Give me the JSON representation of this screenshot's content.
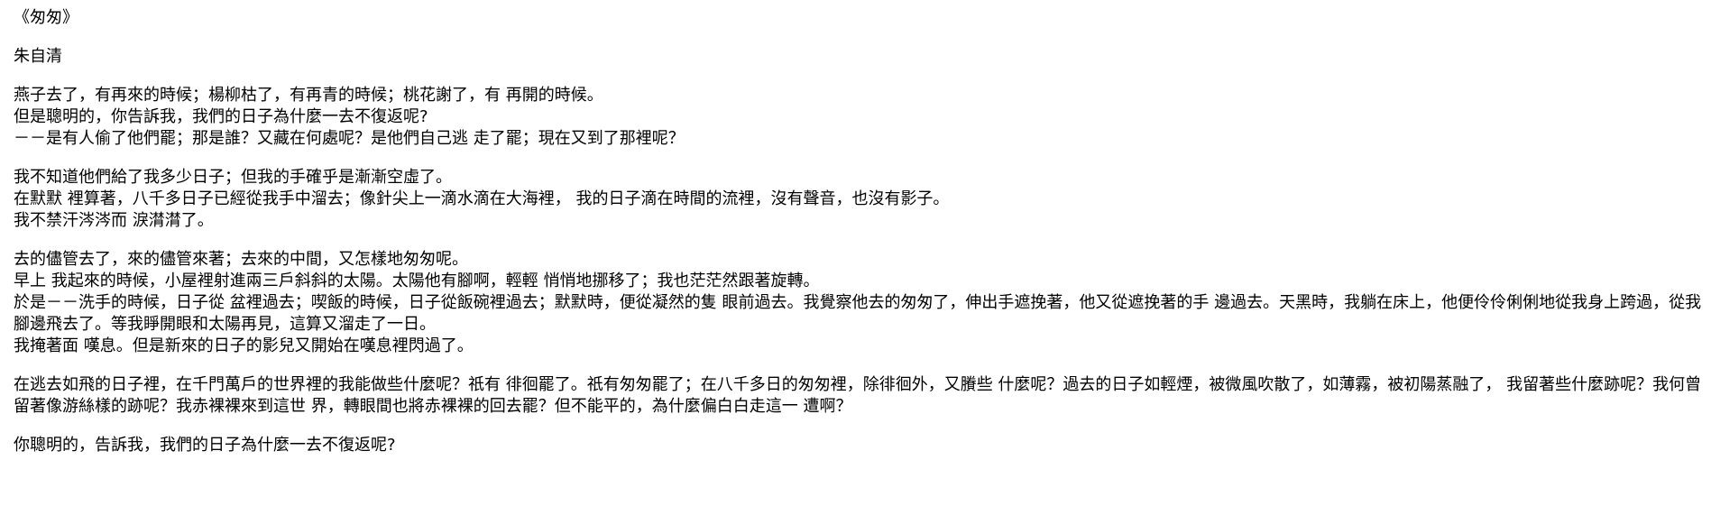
{
  "title": "《匆匆》",
  "author": "朱自清",
  "paragraphs": [
    {
      "lines": [
        "燕子去了，有再來的時候；楊柳枯了，有再青的時候；桃花謝了，有 再開的時候。",
        "但是聰明的，你告訴我，我們的日子為什麼一去不復返呢?",
        "－－是有人偷了他們罷；那是誰？又藏在何處呢？是他們自己逃 走了罷；現在又到了那裡呢？"
      ]
    },
    {
      "lines": [
        "我不知道他們給了我多少日子；但我的手確乎是漸漸空虛了。",
        "在默默 裡算著，八千多日子已經從我手中溜去；像針尖上一滴水滴在大海裡， 我的日子滴在時間的流裡，沒有聲音，也沒有影子。",
        "我不禁汗涔涔而 淚潸潸了。"
      ]
    },
    {
      "lines": [
        "去的儘管去了，來的儘管來著；去來的中間，又怎樣地匆匆呢。",
        "早上 我起來的時候，小屋裡射進兩三戶斜斜的太陽。太陽他有腳啊，輕輕 悄悄地挪移了；我也茫茫然跟著旋轉。",
        "於是－－洗手的時候，日子從 盆裡過去；喫飯的時候，日子從飯碗裡過去；默默時，便從凝然的隻 眼前過去。我覺察他去的匆匆了，伸出手遮挽著，他又從遮挽著的手 邊過去。天黑時，我躺在床上，他便伶伶俐俐地從我身上跨過，從我 腳邊飛去了。等我睜開眼和太陽再見，這算又溜走了一日。",
        "我掩著面 嘆息。但是新來的日子的影兒又開始在嘆息裡閃過了。"
      ]
    },
    {
      "lines": [
        "在逃去如飛的日子裡，在千門萬戶的世界裡的我能做些什麼呢？祇有 徘徊罷了。祇有匆匆罷了；在八千多日的匆匆裡，除徘徊外，又賸些 什麼呢？過去的日子如輕煙，被微風吹散了，如薄霧，被初陽蒸融了， 我留著些什麼跡呢？我何曾留著像游絲樣的跡呢？我赤裸裸來到這世 界，轉眼間也將赤裸裸的回去罷？但不能平的，為什麼偏白白走這一 遭啊？"
      ]
    },
    {
      "lines": [
        "你聰明的，告訴我，我們的日子為什麼一去不復返呢?"
      ]
    }
  ]
}
